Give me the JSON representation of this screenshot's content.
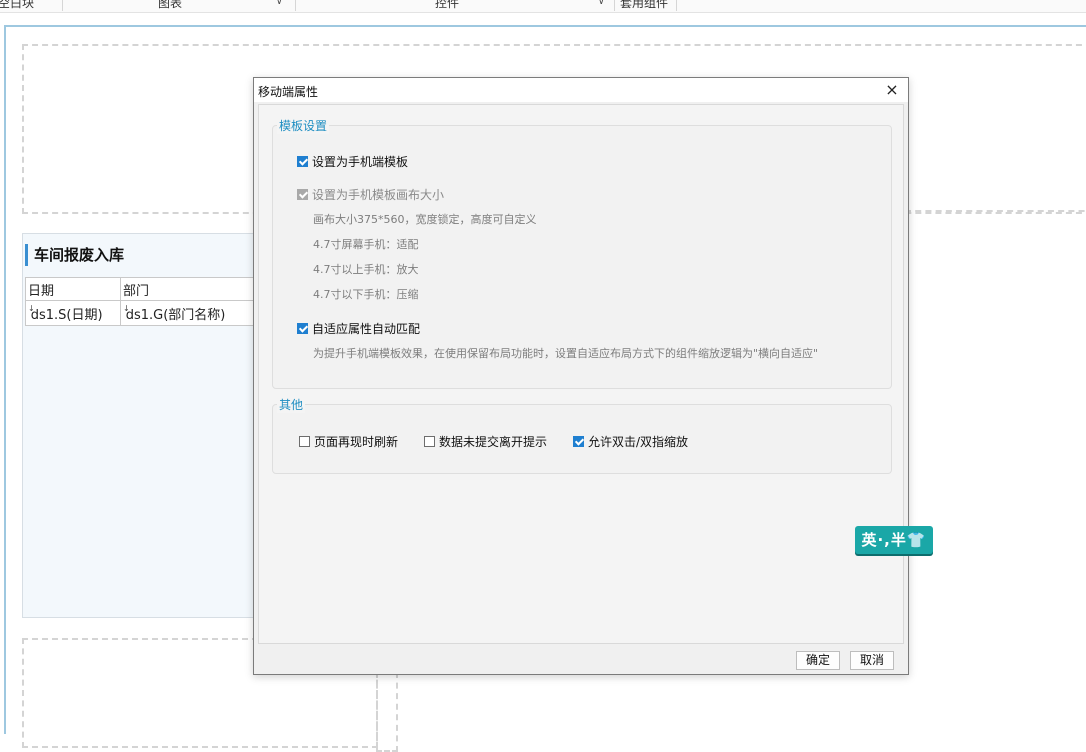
{
  "toolbar": {
    "items": [
      "空白块",
      "图表",
      "控件",
      "套用组件"
    ]
  },
  "report": {
    "title": "车间报废入库",
    "headers": [
      "日期",
      "部门"
    ],
    "cells": [
      "ds1.S(日期)",
      "ds1.G(部门名称)"
    ]
  },
  "dialog": {
    "title": "移动端属性",
    "close_symbol": "×",
    "group1": {
      "label": "模板设置",
      "opt_template": "设置为手机端模板",
      "opt_canvas": "设置为手机模板画布大小",
      "canvas_desc": "画布大小375*560，宽度锁定，高度可自定义",
      "desc_1": "4.7寸屏幕手机：适配",
      "desc_2": "4.7寸以上手机：放大",
      "desc_3": "4.7寸以下手机：压缩",
      "opt_adaptive": "自适应属性自动匹配",
      "adaptive_desc": "为提升手机端模板效果，在使用保留布局功能时，设置自适应布局方式下的组件缩放逻辑为\"横向自适应\""
    },
    "group2": {
      "label": "其他",
      "opt_refresh": "页面再现时刷新",
      "opt_unsubmitted": "数据未提交离开提示",
      "opt_zoom": "允许双击/双指缩放"
    },
    "ok_label": "确定",
    "cancel_label": "取消"
  },
  "ime": {
    "label": "英·,半👕"
  }
}
